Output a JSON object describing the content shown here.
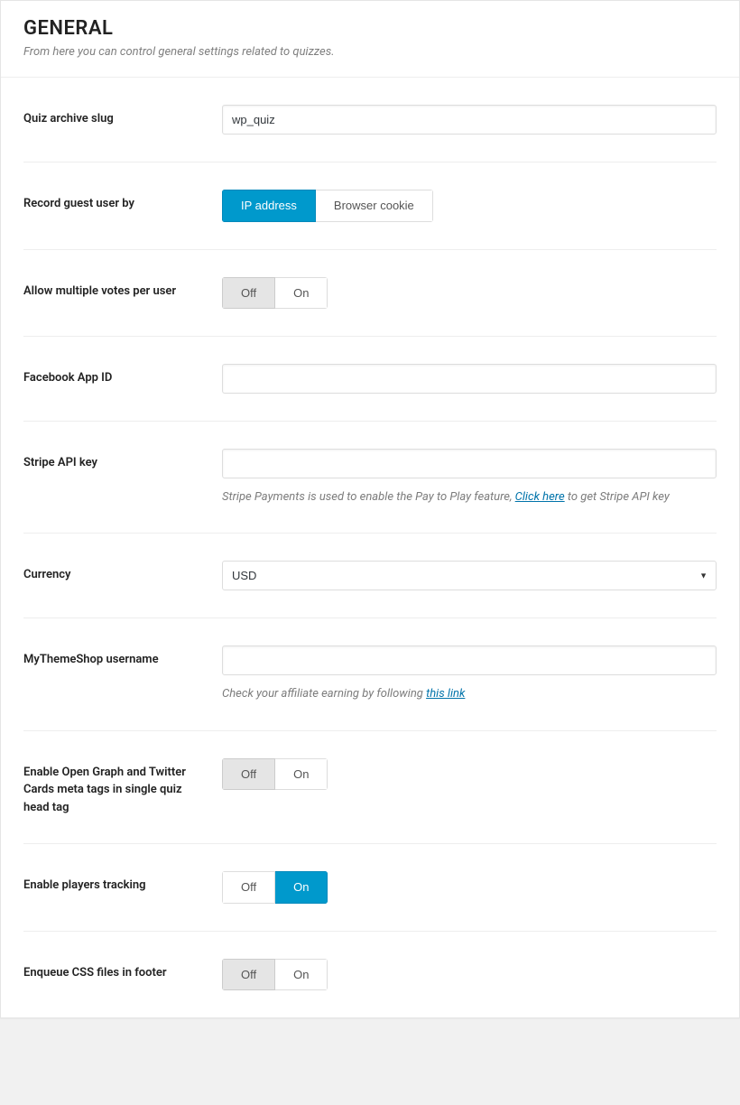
{
  "header": {
    "title": "GENERAL",
    "description": "From here you can control general settings related to quizzes."
  },
  "fields": {
    "quiz_slug": {
      "label": "Quiz archive slug",
      "value": "wp_quiz"
    },
    "record_guest": {
      "label": "Record guest user by",
      "option_ip": "IP address",
      "option_cookie": "Browser cookie"
    },
    "multiple_votes": {
      "label": "Allow multiple votes per user",
      "off": "Off",
      "on": "On"
    },
    "fb_app": {
      "label": "Facebook App ID",
      "value": ""
    },
    "stripe": {
      "label": "Stripe API key",
      "value": "",
      "help_prefix": "Stripe Payments is used to enable the Pay to Play feature, ",
      "help_link": "Click here",
      "help_suffix": " to get Stripe API key"
    },
    "currency": {
      "label": "Currency",
      "selected": "USD"
    },
    "mts_user": {
      "label": "MyThemeShop username",
      "value": "",
      "help_prefix": "Check your affiliate earning by following ",
      "help_link": "this link"
    },
    "og_tags": {
      "label": "Enable Open Graph and Twitter Cards meta tags in single quiz head tag",
      "off": "Off",
      "on": "On"
    },
    "tracking": {
      "label": "Enable players tracking",
      "off": "Off",
      "on": "On"
    },
    "css_footer": {
      "label": "Enqueue CSS files in footer",
      "off": "Off",
      "on": "On"
    }
  }
}
